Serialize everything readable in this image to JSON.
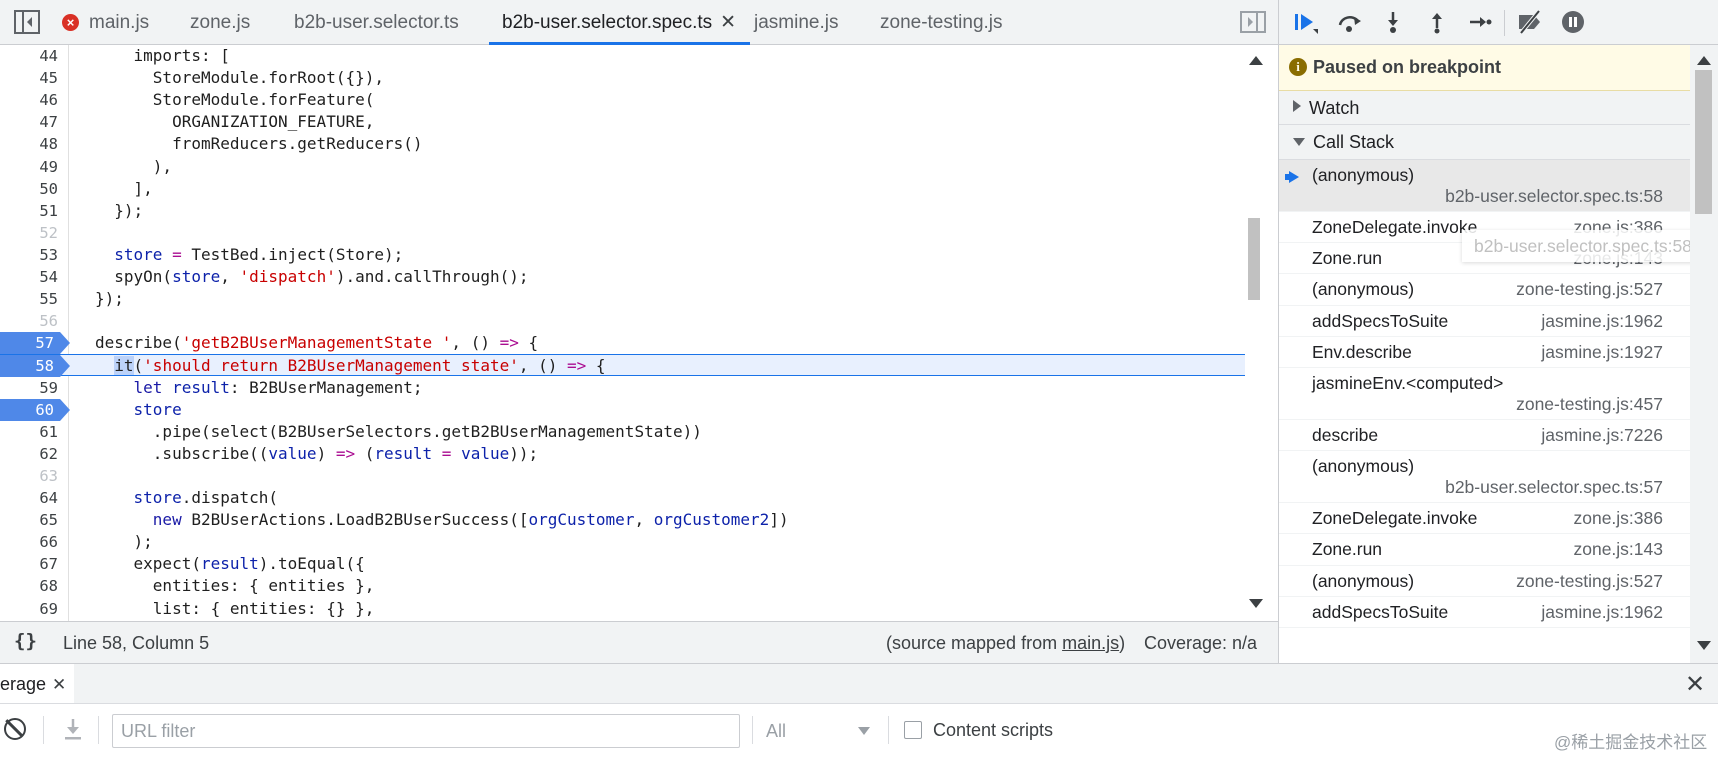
{
  "tabs": [
    {
      "label": "main.js",
      "has_error": true
    },
    {
      "label": "zone.js"
    },
    {
      "label": "b2b-user.selector.ts"
    },
    {
      "label": "b2b-user.selector.spec.ts",
      "active": true,
      "closable": true
    },
    {
      "label": "jasmine.js"
    },
    {
      "label": "zone-testing.js"
    }
  ],
  "tab_close_glyph": "✕",
  "error_glyph": "×",
  "editor": {
    "current_line": 58,
    "breakpoints": [
      57,
      58,
      60
    ],
    "lines": [
      {
        "n": "44",
        "code": "    imports: ["
      },
      {
        "n": "45",
        "code": "      StoreModule.forRoot({}),"
      },
      {
        "n": "46",
        "code": "      StoreModule.forFeature("
      },
      {
        "n": "47",
        "code": "        ORGANIZATION_FEATURE,"
      },
      {
        "n": "48",
        "code": "        fromReducers.getReducers()"
      },
      {
        "n": "49",
        "code": "      ),"
      },
      {
        "n": "50",
        "code": "    ],"
      },
      {
        "n": "51",
        "code": "  });"
      },
      {
        "n": "52",
        "code": "",
        "dim": true
      },
      {
        "n": "53",
        "code": "  store = TestBed.inject(Store);"
      },
      {
        "n": "54",
        "code": "  spyOn(store, 'dispatch').and.callThrough();"
      },
      {
        "n": "55",
        "code": "});"
      },
      {
        "n": "56",
        "code": "",
        "dim": true
      },
      {
        "n": "57",
        "code": "describe('getB2BUserManagementState ', () => {"
      },
      {
        "n": "58",
        "code": "  it('should return B2BUserManagement state', () => {"
      },
      {
        "n": "59",
        "code": "    let result: B2BUserManagement;"
      },
      {
        "n": "60",
        "code": "    store"
      },
      {
        "n": "61",
        "code": "      .pipe(select(B2BUserSelectors.getB2BUserManagementState))"
      },
      {
        "n": "62",
        "code": "      .subscribe((value) => (result = value));"
      },
      {
        "n": "63",
        "code": "",
        "dim": true
      },
      {
        "n": "64",
        "code": "    store.dispatch("
      },
      {
        "n": "65",
        "code": "      new B2BUserActions.LoadB2BUserSuccess([orgCustomer, orgCustomer2])"
      },
      {
        "n": "66",
        "code": "    );"
      },
      {
        "n": "67",
        "code": "    expect(result).toEqual({"
      },
      {
        "n": "68",
        "code": "      entities: { entities },"
      },
      {
        "n": "69",
        "code": "      list: { entities: {} },"
      }
    ]
  },
  "status": {
    "pretty_print": "{}",
    "cursor": "Line 58, Column 5",
    "source_mapped_prefix": "(source mapped from ",
    "source_mapped_link": "main.js",
    "source_mapped_suffix": ")",
    "coverage": "Coverage: n/a"
  },
  "debugger": {
    "paused_icon": "i",
    "paused_text": "Paused on breakpoint",
    "watch_label": "Watch",
    "call_stack_label": "Call Stack",
    "tooltip": "b2b-user.selector.spec.ts:58",
    "frames": [
      {
        "fn": "(anonymous)",
        "loc": "b2b-user.selector.spec.ts:58",
        "two_line": true,
        "selected": true
      },
      {
        "fn": "ZoneDelegate.invoke",
        "loc": "zone.js:386"
      },
      {
        "fn": "Zone.run",
        "loc": "zone.js:143"
      },
      {
        "fn": "(anonymous)",
        "loc": "zone-testing.js:527"
      },
      {
        "fn": "addSpecsToSuite",
        "loc": "jasmine.js:1962"
      },
      {
        "fn": "Env.describe",
        "loc": "jasmine.js:1927"
      },
      {
        "fn": "jasmineEnv.<computed>",
        "loc": "zone-testing.js:457",
        "two_line": true
      },
      {
        "fn": "describe",
        "loc": "jasmine.js:7226"
      },
      {
        "fn": "(anonymous)",
        "loc": "b2b-user.selector.spec.ts:57",
        "two_line": true
      },
      {
        "fn": "ZoneDelegate.invoke",
        "loc": "zone.js:386"
      },
      {
        "fn": "Zone.run",
        "loc": "zone.js:143"
      },
      {
        "fn": "(anonymous)",
        "loc": "zone-testing.js:527"
      },
      {
        "fn": "addSpecsToSuite",
        "loc": "jasmine.js:1962"
      }
    ]
  },
  "drawer": {
    "tab_label": "erage",
    "tab_close": "✕",
    "close": "✕",
    "url_filter_placeholder": "URL filter",
    "type_select": "All",
    "content_scripts_label": "Content scripts"
  },
  "watermark": "@稀土掘金技术社区",
  "colors": {
    "accent": "#1a73e8",
    "breakpoint": "#4f88e8",
    "paused_banner": "#fffbe6",
    "error": "#d93025"
  }
}
